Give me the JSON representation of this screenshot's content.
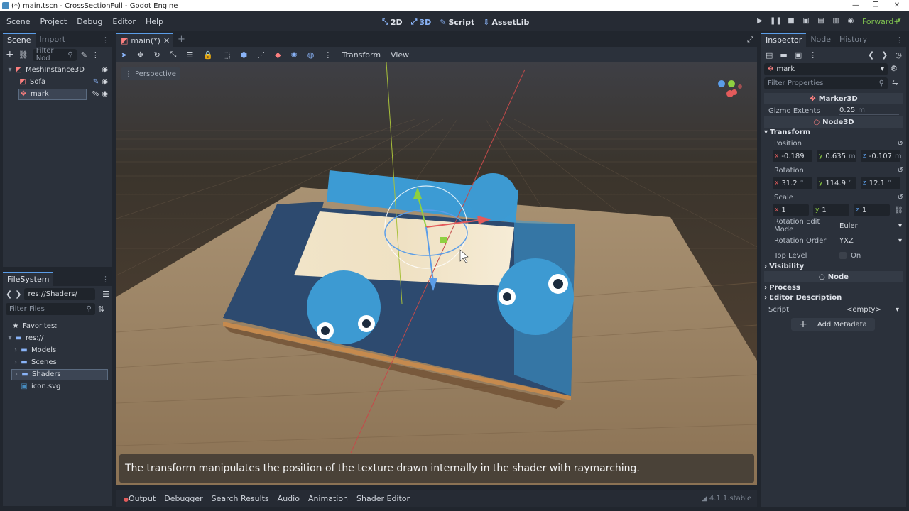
{
  "window": {
    "title": "(*) main.tscn - CrossSectionFull - Godot Engine",
    "minimize": "—",
    "restore": "❐",
    "close": "✕"
  },
  "menu": [
    "Scene",
    "Project",
    "Debug",
    "Editor",
    "Help"
  ],
  "main_tabs": [
    {
      "icon": "⤡",
      "label": "2D"
    },
    {
      "icon": "⤢",
      "label": "3D"
    },
    {
      "icon": "✎",
      "label": "Script"
    },
    {
      "icon": "⇩",
      "label": "AssetLib"
    }
  ],
  "renderer": "Forward+",
  "scene_dock": {
    "tabs": [
      "Scene",
      "Import"
    ],
    "filter_placeholder": "Filter Nod",
    "nodes": [
      {
        "name": "MeshInstance3D",
        "depth": 0
      },
      {
        "name": "Sofa",
        "depth": 1
      },
      {
        "name": "mark",
        "depth": 1,
        "selected": true
      }
    ]
  },
  "filesystem": {
    "tab": "FileSystem",
    "path": "res://Shaders/",
    "filter_placeholder": "Filter Files",
    "items": [
      {
        "label": "Favorites:",
        "kind": "fav",
        "depth": 0
      },
      {
        "label": "res://",
        "kind": "folder",
        "depth": 0
      },
      {
        "label": "Models",
        "kind": "folder",
        "depth": 1
      },
      {
        "label": "Scenes",
        "kind": "folder",
        "depth": 1
      },
      {
        "label": "Shaders",
        "kind": "folder",
        "depth": 1,
        "selected": true
      },
      {
        "label": "icon.svg",
        "kind": "file",
        "depth": 1
      }
    ]
  },
  "editor_tab": {
    "label": "main(*)"
  },
  "viewport_toolbar": {
    "transform": "Transform",
    "view": "View",
    "perspective": "Perspective"
  },
  "subtitle": "The transform manipulates the position of the texture drawn internally in the shader with raymarching.",
  "bottom_panel": {
    "tabs": [
      "Output",
      "Debugger",
      "Search Results",
      "Audio",
      "Animation",
      "Shader Editor"
    ],
    "version": "4.1.1.stable"
  },
  "inspector": {
    "tabs": [
      "Inspector",
      "Node",
      "History"
    ],
    "node_name": "mark",
    "filter_placeholder": "Filter Properties",
    "class_marker": "Marker3D",
    "gizmo_extents_label": "Gizmo Extents",
    "gizmo_extents_value": "0.25",
    "gizmo_extents_unit": "m",
    "class_node3d": "Node3D",
    "transform_section": "Transform",
    "position_label": "Position",
    "position": {
      "x": "-0.189",
      "y": "0.635",
      "z": "-0.107",
      "unit": "m"
    },
    "rotation_label": "Rotation",
    "rotation": {
      "x": "31.2",
      "y": "114.9",
      "z": "12.1",
      "unit": "°"
    },
    "scale_label": "Scale",
    "scale": {
      "x": "1",
      "y": "1",
      "z": "1"
    },
    "rotation_edit_mode_label": "Rotation Edit Mode",
    "rotation_edit_mode": "Euler",
    "rotation_order_label": "Rotation Order",
    "rotation_order": "YXZ",
    "top_level_label": "Top Level",
    "top_level_value": "On",
    "visibility_section": "Visibility",
    "class_node": "Node",
    "process_section": "Process",
    "editor_description_section": "Editor Description",
    "script_label": "Script",
    "script_value": "<empty>",
    "add_metadata": "Add Metadata"
  },
  "colors": {
    "accent": "#5b9de8",
    "panel": "#2b313b",
    "background": "#21262e",
    "renderer_green": "#7ec04f"
  }
}
